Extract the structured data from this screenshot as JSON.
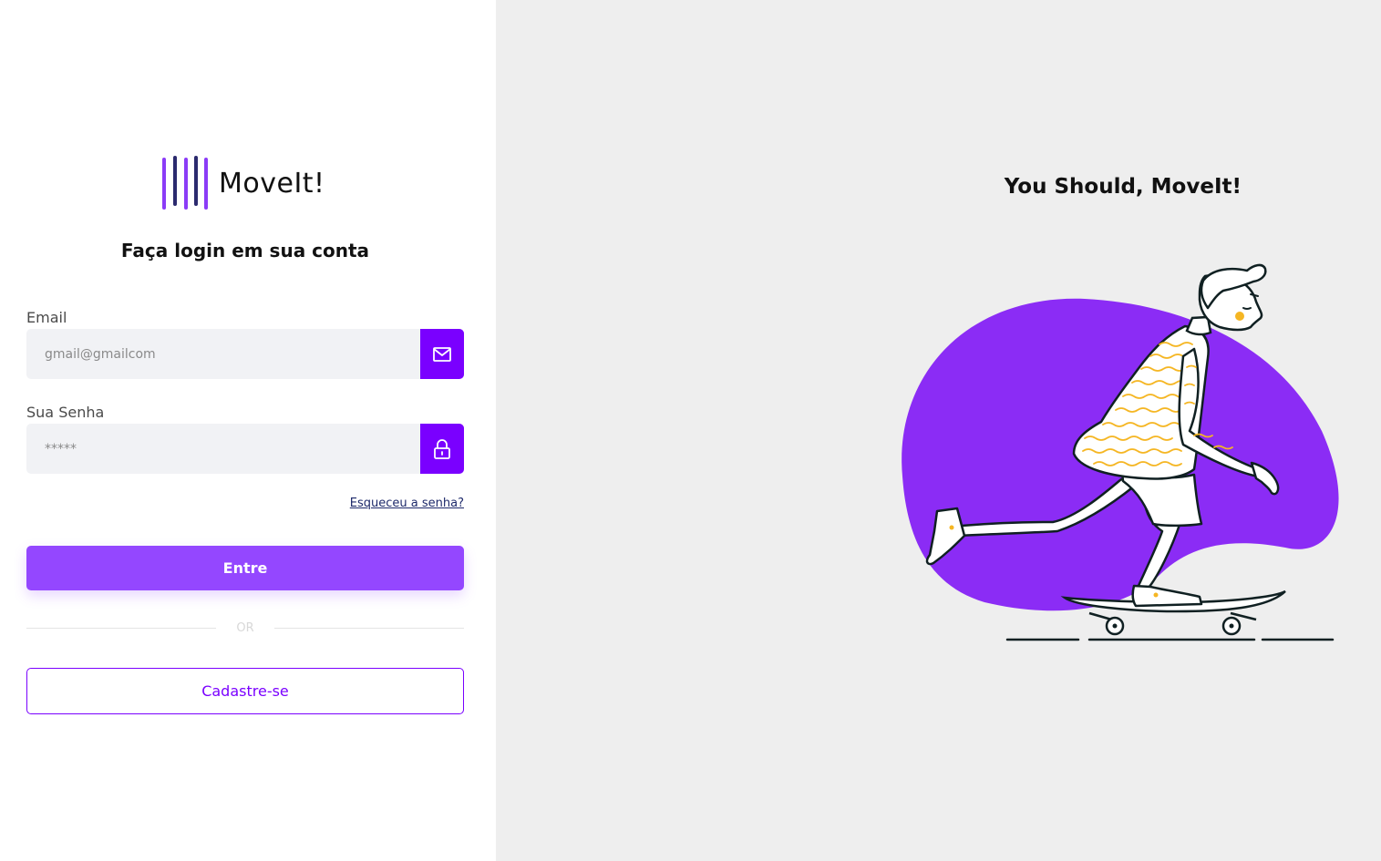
{
  "brand": {
    "name": "MoveIt!",
    "primary_color": "#7a00ff",
    "button_color": "#9447ff"
  },
  "login": {
    "title": "Faça login em sua conta",
    "email_label": "Email",
    "email_placeholder": "gmail@gmailcom",
    "email_icon": "mail-icon",
    "password_label": "Sua Senha",
    "password_placeholder": "*****",
    "password_icon": "lock-icon",
    "forgot_label": "Esqueceu a senha?",
    "enter_label": "Entre",
    "divider_label": "OR",
    "signup_label": "Cadastre-se"
  },
  "hero": {
    "title": "You Should, MoveIt!",
    "illustration": "skateboarder-illustration",
    "blob_color": "#8b2cf5",
    "accent_color": "#f5b623"
  }
}
